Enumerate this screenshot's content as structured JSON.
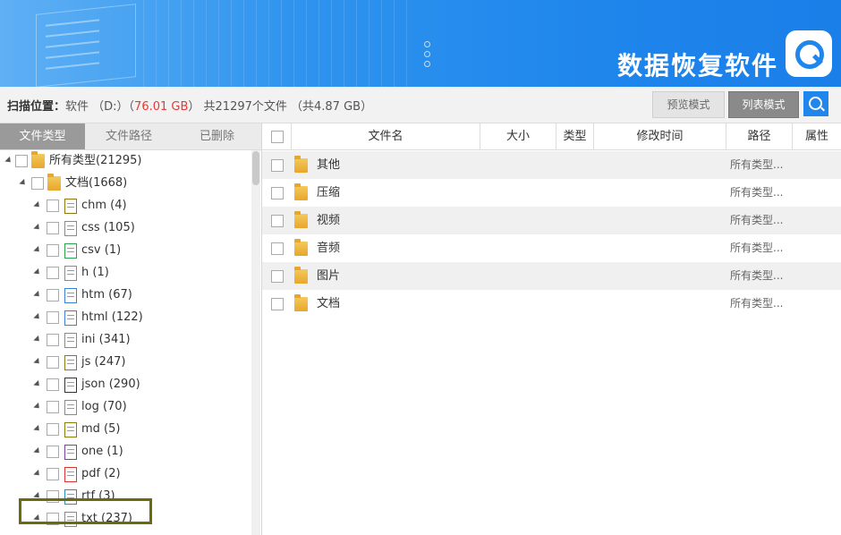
{
  "header": {
    "brand_title": "数据恢复软件"
  },
  "scan_bar": {
    "label": "扫描位置：",
    "prefix": "软件 （D:）（",
    "size": "76.01 GB",
    "suffix": "） 共21297个文件 （共4.87 GB）",
    "preview_mode": "预览模式",
    "list_mode": "列表模式",
    "search_icon": "search-icon"
  },
  "left_tabs": [
    {
      "label": "文件类型",
      "active": true
    },
    {
      "label": "文件路径",
      "active": false
    },
    {
      "label": "已删除",
      "active": false
    }
  ],
  "tree": {
    "root": "所有类型(21295)",
    "documents": "文档(1668)",
    "items": [
      {
        "label": "chm (4)",
        "icon": "chm-file-icon"
      },
      {
        "label": "css (105)",
        "icon": "css-file-icon"
      },
      {
        "label": "csv (1)",
        "icon": "csv-file-icon"
      },
      {
        "label": "h (1)",
        "icon": "h-file-icon"
      },
      {
        "label": "htm (67)",
        "icon": "htm-file-icon"
      },
      {
        "label": "html (122)",
        "icon": "html-file-icon"
      },
      {
        "label": "ini (341)",
        "icon": "ini-file-icon"
      },
      {
        "label": "js (247)",
        "icon": "js-file-icon"
      },
      {
        "label": "json (290)",
        "icon": "json-file-icon"
      },
      {
        "label": "log (70)",
        "icon": "log-file-icon"
      },
      {
        "label": "md (5)",
        "icon": "md-file-icon"
      },
      {
        "label": "one (1)",
        "icon": "one-file-icon"
      },
      {
        "label": "pdf (2)",
        "icon": "pdf-file-icon"
      },
      {
        "label": "rtf (3)",
        "icon": "rtf-file-icon"
      },
      {
        "label": "txt (237)",
        "icon": "txt-file-icon"
      }
    ]
  },
  "table": {
    "headers": [
      "文件名",
      "大小",
      "类型",
      "修改时间",
      "路径",
      "属性"
    ],
    "rows": [
      {
        "name": "其他",
        "path": "所有类型..."
      },
      {
        "name": "压缩",
        "path": "所有类型..."
      },
      {
        "name": "视频",
        "path": "所有类型..."
      },
      {
        "name": "音频",
        "path": "所有类型..."
      },
      {
        "name": "图片",
        "path": "所有类型..."
      },
      {
        "name": "文档",
        "path": "所有类型..."
      }
    ]
  }
}
